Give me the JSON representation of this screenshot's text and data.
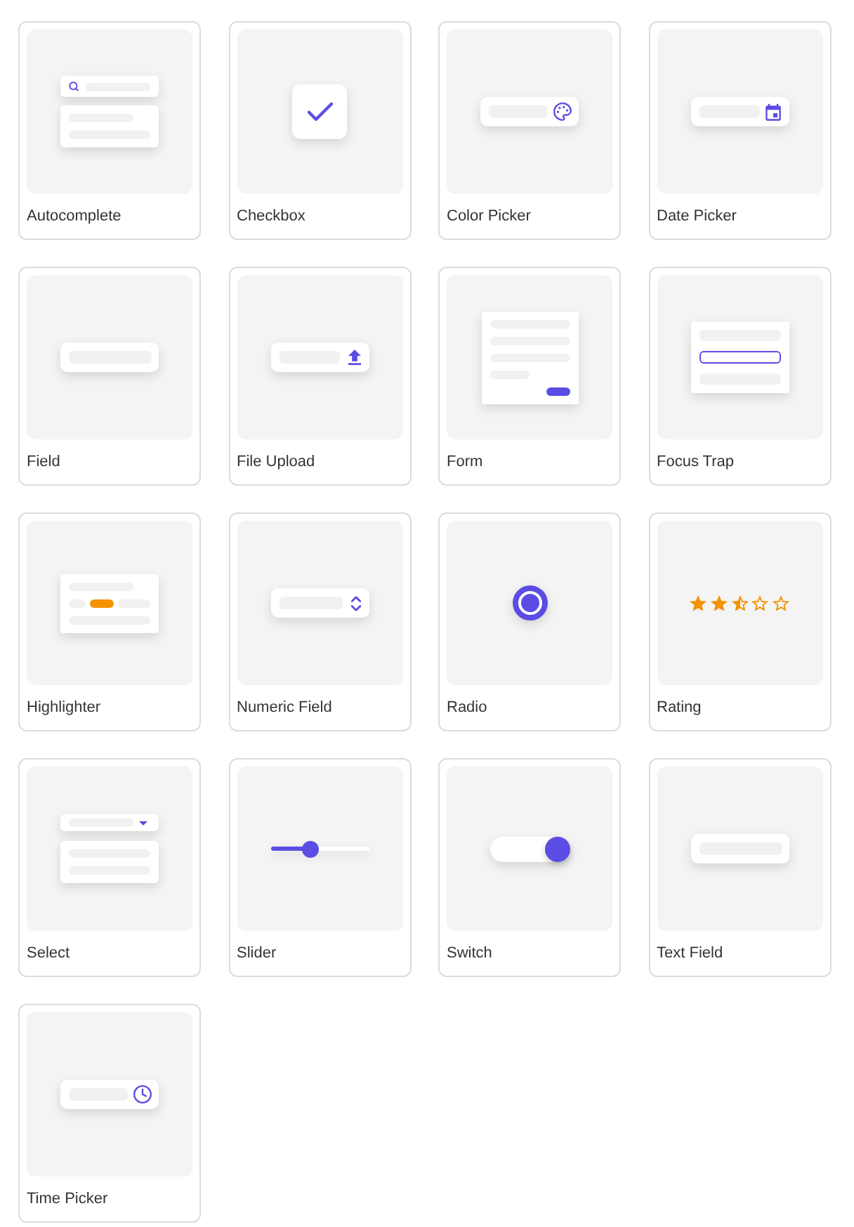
{
  "components": [
    {
      "label": "Autocomplete",
      "kind": "autocomplete"
    },
    {
      "label": "Checkbox",
      "kind": "checkbox",
      "checked": true
    },
    {
      "label": "Color Picker",
      "kind": "color-picker"
    },
    {
      "label": "Date Picker",
      "kind": "date-picker"
    },
    {
      "label": "Field",
      "kind": "field"
    },
    {
      "label": "File Upload",
      "kind": "file-upload"
    },
    {
      "label": "Form",
      "kind": "form"
    },
    {
      "label": "Focus Trap",
      "kind": "focus-trap"
    },
    {
      "label": "Highlighter",
      "kind": "highlighter"
    },
    {
      "label": "Numeric Field",
      "kind": "numeric-field"
    },
    {
      "label": "Radio",
      "kind": "radio",
      "checked": true
    },
    {
      "label": "Rating",
      "kind": "rating",
      "stars": 2.5
    },
    {
      "label": "Select",
      "kind": "select"
    },
    {
      "label": "Slider",
      "kind": "slider",
      "level": 0.41
    },
    {
      "label": "Switch",
      "kind": "switch",
      "on": true
    },
    {
      "label": "Text Field",
      "kind": "text-field"
    },
    {
      "label": "Time Picker",
      "kind": "time-picker"
    }
  ]
}
